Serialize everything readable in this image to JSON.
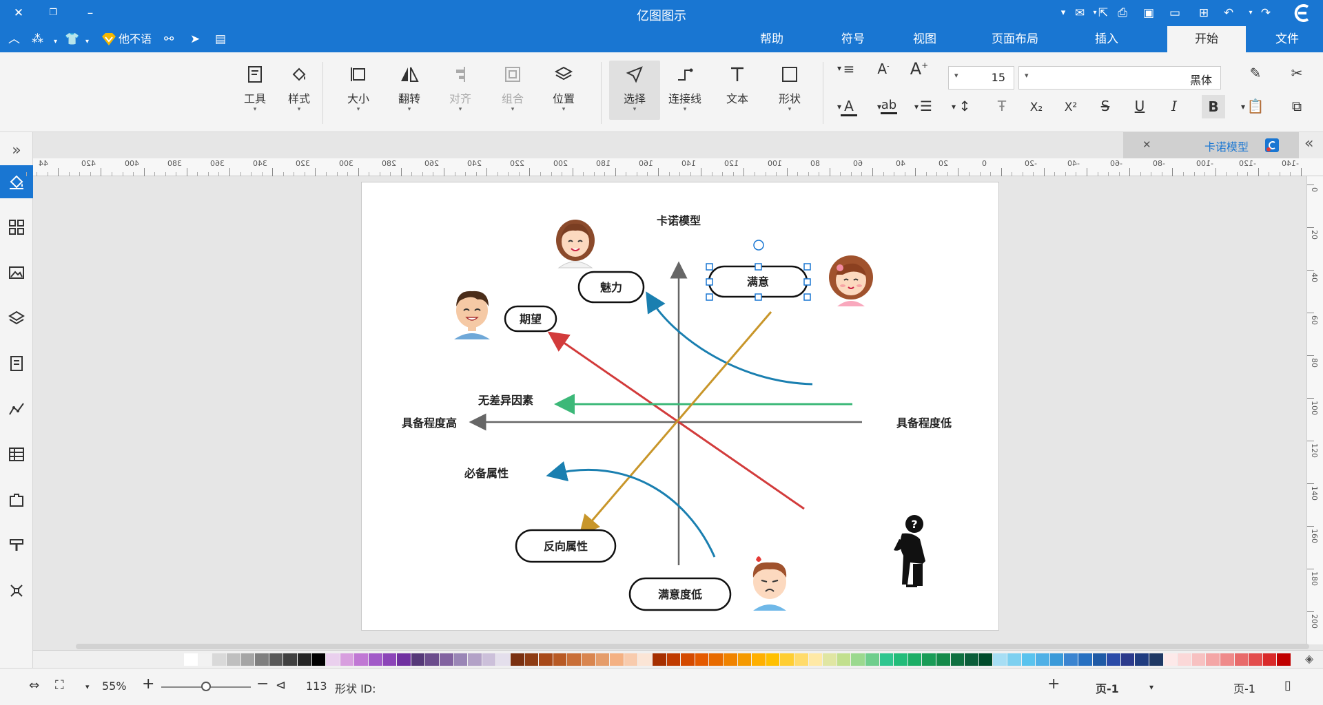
{
  "app": {
    "title": "亿图图示"
  },
  "menu": {
    "items": [
      "文件",
      "开始",
      "插入",
      "页面布局",
      "视图",
      "符号",
      "帮助"
    ],
    "active": "开始",
    "user_name": "他不语"
  },
  "ribbon": {
    "font_name": "黑体",
    "font_size": "15",
    "tools": {
      "shape": "形状",
      "text": "文本",
      "connector": "连接线",
      "select": "选择",
      "position": "位置",
      "group": "组合",
      "align": "对齐",
      "flip": "翻转",
      "size": "大小",
      "style": "样式",
      "tools": "工具"
    },
    "format_glyphs": {
      "bold": "B",
      "italic": "I",
      "underline": "U",
      "strike": "S",
      "subscript": "X₂",
      "superscript": "X²",
      "grow": "A",
      "shrink": "A",
      "font_color": "A",
      "highlight": "ab"
    }
  },
  "document": {
    "tab_name": "卡诺模型"
  },
  "ruler": {
    "h_labels": [
      "-140",
      "-120",
      "-100",
      "-80",
      "-60",
      "-40",
      "-20",
      "0",
      "20",
      "40",
      "60",
      "80",
      "100",
      "120",
      "140",
      "160",
      "180",
      "200",
      "220",
      "240",
      "260",
      "280",
      "300",
      "320",
      "340",
      "360",
      "380",
      "400",
      "420",
      "44"
    ],
    "v_labels": [
      "0",
      "20",
      "40",
      "60",
      "80",
      "100",
      "120",
      "140",
      "160",
      "180",
      "200"
    ]
  },
  "diagram": {
    "title": "卡诺模型",
    "labels": {
      "satisfied": "满意",
      "charm": "魅力",
      "expected": "期望",
      "indifferent": "无差异因素",
      "high_provision": "具备程度高",
      "low_provision": "具备程度低",
      "must_be": "必备属性",
      "reverse": "反向属性",
      "dissatisfied": "满意度低"
    },
    "colors": {
      "charm_curve": "#1a7fb0",
      "expected_line": "#d23b3b",
      "indifferent_line": "#3cb878",
      "reverse_line": "#c8962a",
      "axis": "#666666"
    }
  },
  "statusbar": {
    "page_label": "页-1",
    "page_tab": "页-1",
    "shape_id_label": "形状 ID:",
    "shape_id": "113",
    "zoom": "55%",
    "zoom_level": 0.55
  },
  "palette": [
    "#c00000",
    "#d92a2a",
    "#e34d4d",
    "#e86a6a",
    "#ef8a8a",
    "#f4a6a6",
    "#f7c1c1",
    "#fbd8d8",
    "#fde9e9",
    "#1f3864",
    "#203c80",
    "#2b3a8c",
    "#2b4ba8",
    "#1f5aa6",
    "#2770c1",
    "#3b84d0",
    "#3a9ad9",
    "#4fb0e6",
    "#5ac3ee",
    "#7dd0f0",
    "#a7def4",
    "#004b2b",
    "#0b5e3a",
    "#0f7040",
    "#148a4a",
    "#199c57",
    "#1cae66",
    "#22bc7a",
    "#2fc68f",
    "#6fce8d",
    "#9bd98f",
    "#c2e08e",
    "#e0e6a3",
    "#ffe9a6",
    "#ffdb6b",
    "#ffce33",
    "#ffc000",
    "#ffb000",
    "#f59a00",
    "#f08300",
    "#e86b00",
    "#e45a00",
    "#d44a00",
    "#c03b00",
    "#a62f00",
    "#fbe5d6",
    "#f8cbad",
    "#f4b183",
    "#e59d6b",
    "#d98650",
    "#c96f38",
    "#b85a25",
    "#a84a1a",
    "#8e3c14",
    "#7a3010",
    "#e4dfec",
    "#ccc0da",
    "#b3a2c7",
    "#9a86b6",
    "#8263a0",
    "#6b4c8c",
    "#553878",
    "#7030a0",
    "#8c44b8",
    "#a25ac8",
    "#c078d4",
    "#d89fdf",
    "#ead0ee",
    "#000000",
    "#262626",
    "#404040",
    "#595959",
    "#7f7f7f",
    "#a5a5a5",
    "#bfbfbf",
    "#d9d9d9",
    "#f2f2f2",
    "#ffffff"
  ]
}
